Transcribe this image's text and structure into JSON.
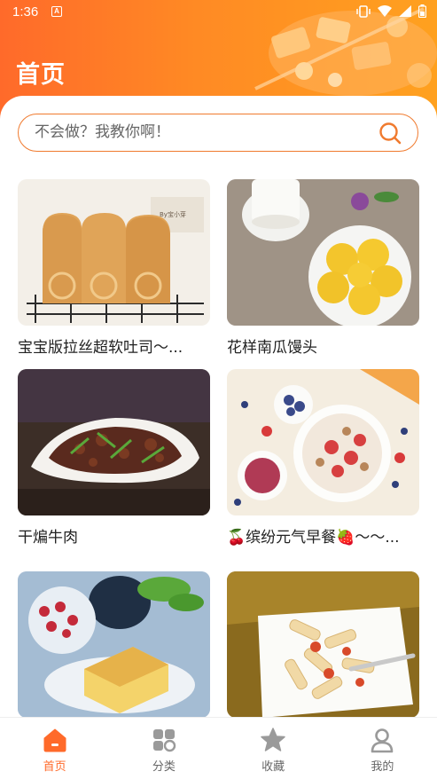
{
  "status_bar": {
    "time": "1:36",
    "app_badge": "A",
    "icons": [
      "vibrate-icon",
      "wifi-icon",
      "signal-icon",
      "battery-icon"
    ]
  },
  "header": {
    "title": "首页"
  },
  "search": {
    "placeholder": "不会做？我教你啊！",
    "icon": "search-icon"
  },
  "recipes": [
    {
      "title": "宝宝版拉丝超软吐司～...",
      "image": "bread-loaf-photo"
    },
    {
      "title": "花样南瓜馒头",
      "image": "pumpkin-buns-photo"
    },
    {
      "title": "干煸牛肉",
      "image": "dry-fried-beef-photo"
    },
    {
      "title": "🍒缤纷元气早餐🍓～～...",
      "image": "breakfast-bowl-photo"
    },
    {
      "title": "",
      "image": "sponge-cake-photo"
    },
    {
      "title": "",
      "image": "penne-pasta-photo"
    }
  ],
  "tabbar": {
    "items": [
      {
        "label": "首页",
        "icon": "home-icon",
        "active": true
      },
      {
        "label": "分类",
        "icon": "category-icon",
        "active": false
      },
      {
        "label": "收藏",
        "icon": "star-icon",
        "active": false
      },
      {
        "label": "我的",
        "icon": "user-icon",
        "active": false
      }
    ]
  },
  "colors": {
    "accent": "#ff6a2a",
    "header_gradient_start": "#ff6a2a",
    "header_gradient_end": "#ffa11f",
    "inactive_icon": "#9a9a9a"
  }
}
